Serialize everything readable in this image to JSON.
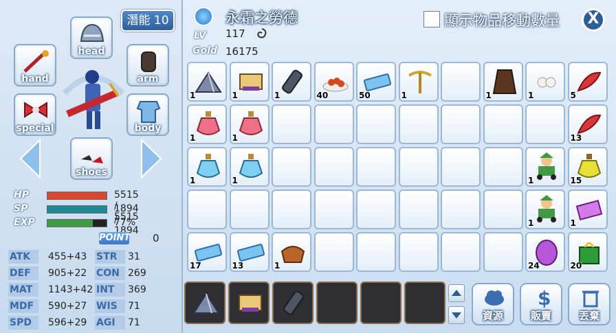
{
  "potential": {
    "label": "潛能 10"
  },
  "equip_slots": {
    "head": "head",
    "hand": "hand",
    "arm": "arm",
    "special": "special",
    "body": "body",
    "shoes": "shoes"
  },
  "vitals": {
    "hp_key": "HP",
    "hp_value": "5515 / 5515",
    "hp_fraction": 1.0,
    "sp_key": "SP",
    "sp_value": "1894 / 1894",
    "sp_fraction": 1.0,
    "exp_key": "EXP",
    "exp_value": "77%",
    "exp_fraction": 0.77
  },
  "point": {
    "label": "POINT",
    "value": "0"
  },
  "attributes": [
    {
      "key": "ATK",
      "value": "455+43"
    },
    {
      "key": "DEF",
      "value": "905+22"
    },
    {
      "key": "MAT",
      "value": "1143+42"
    },
    {
      "key": "MDF",
      "value": "590+27"
    },
    {
      "key": "SPD",
      "value": "596+29"
    },
    {
      "key": "STR",
      "value": "31"
    },
    {
      "key": "CON",
      "value": "269"
    },
    {
      "key": "INT",
      "value": "369"
    },
    {
      "key": "WIS",
      "value": "71"
    },
    {
      "key": "AGI",
      "value": "71"
    }
  ],
  "character": {
    "name": "永霜之勞德",
    "lv_key": "LV",
    "level": "117",
    "gold_key": "Gold",
    "gold": "16175"
  },
  "toggle_label": "顯示物品移動數量",
  "close_label": "X",
  "inventory": [
    {
      "icon": "tent-icon",
      "count": "1"
    },
    {
      "icon": "scroll-icon",
      "count": "1"
    },
    {
      "icon": "remote-icon",
      "count": "1"
    },
    {
      "icon": "food-plate-icon",
      "count": "40"
    },
    {
      "icon": "ticket-icon",
      "count": "50"
    },
    {
      "icon": "pickaxe-icon",
      "count": "1"
    },
    {
      "icon": "",
      "count": ""
    },
    {
      "icon": "cloak-icon",
      "count": "1"
    },
    {
      "icon": "pearl-icon",
      "count": "1"
    },
    {
      "icon": "feather-icon",
      "count": "5"
    },
    {
      "icon": "red-potion-icon",
      "count": "1"
    },
    {
      "icon": "red-potion-icon",
      "count": "1"
    },
    {
      "icon": "",
      "count": ""
    },
    {
      "icon": "",
      "count": ""
    },
    {
      "icon": "",
      "count": ""
    },
    {
      "icon": "",
      "count": ""
    },
    {
      "icon": "",
      "count": ""
    },
    {
      "icon": "",
      "count": ""
    },
    {
      "icon": "",
      "count": ""
    },
    {
      "icon": "feather-icon",
      "count": "13"
    },
    {
      "icon": "blue-potion-icon",
      "count": "1"
    },
    {
      "icon": "blue-potion-icon",
      "count": "1"
    },
    {
      "icon": "",
      "count": ""
    },
    {
      "icon": "",
      "count": ""
    },
    {
      "icon": "",
      "count": ""
    },
    {
      "icon": "",
      "count": ""
    },
    {
      "icon": "",
      "count": ""
    },
    {
      "icon": "",
      "count": ""
    },
    {
      "icon": "elf-kart-icon",
      "count": "1"
    },
    {
      "icon": "yellow-potion-icon",
      "count": "15"
    },
    {
      "icon": "",
      "count": ""
    },
    {
      "icon": "",
      "count": ""
    },
    {
      "icon": "",
      "count": ""
    },
    {
      "icon": "",
      "count": ""
    },
    {
      "icon": "",
      "count": ""
    },
    {
      "icon": "",
      "count": ""
    },
    {
      "icon": "",
      "count": ""
    },
    {
      "icon": "",
      "count": ""
    },
    {
      "icon": "elf-kart-icon",
      "count": "1"
    },
    {
      "icon": "purple-card-icon",
      "count": "1"
    },
    {
      "icon": "ticket-icon",
      "count": "17"
    },
    {
      "icon": "ticket-icon",
      "count": "13"
    },
    {
      "icon": "saddle-icon",
      "count": "1"
    },
    {
      "icon": "",
      "count": ""
    },
    {
      "icon": "",
      "count": ""
    },
    {
      "icon": "",
      "count": ""
    },
    {
      "icon": "",
      "count": ""
    },
    {
      "icon": "",
      "count": ""
    },
    {
      "icon": "purple-egg-icon",
      "count": "24"
    },
    {
      "icon": "gift-bag-icon",
      "count": "20"
    }
  ],
  "quick_slots": [
    "tent-icon",
    "scroll-icon",
    "remote-icon",
    "",
    "",
    ""
  ],
  "actions": {
    "resource": "資源",
    "sell": "販賣",
    "discard": "丟棄"
  },
  "colors": {
    "hp": "#d9472f",
    "sp": "#1f8a95",
    "exp": "#3e9a45"
  }
}
